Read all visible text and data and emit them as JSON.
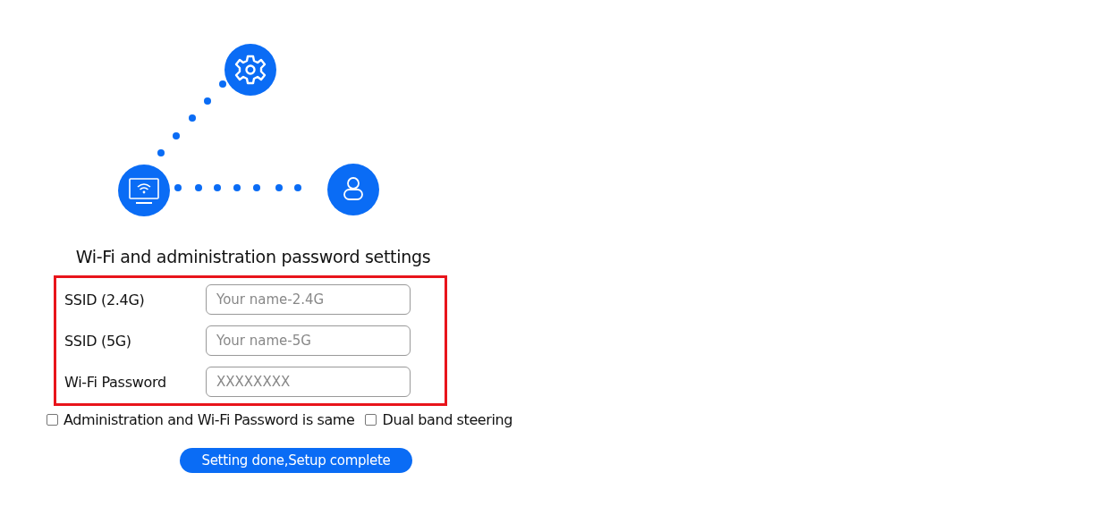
{
  "title": "Wi-Fi and administration password settings",
  "fields": [
    {
      "label": "SSID (2.4G)",
      "placeholder": "Your name-2.4G"
    },
    {
      "label": "SSID (5G)",
      "placeholder": "Your name-5G"
    },
    {
      "label": "Wi-Fi Password",
      "placeholder": "XXXXXXXX"
    }
  ],
  "options": [
    {
      "label": "Administration and Wi-Fi Password is same",
      "checked": false
    },
    {
      "label": "Dual band steering",
      "checked": false
    }
  ],
  "button": "Setting done,Setup complete"
}
